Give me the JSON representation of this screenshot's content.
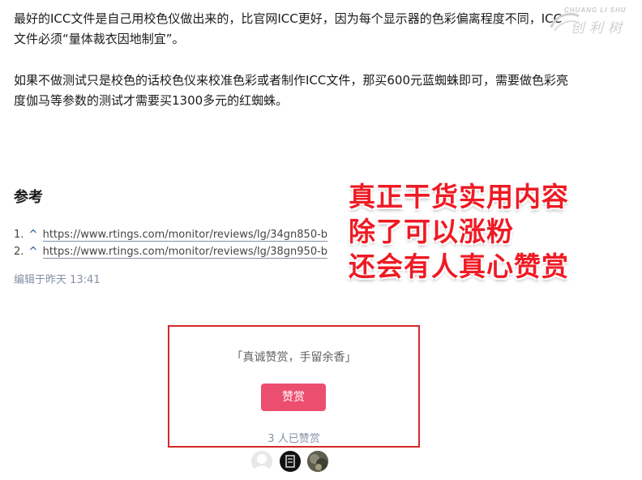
{
  "article": {
    "para1": "最好的ICC文件是自己用校色仪做出来的，比官网ICC更好，因为每个显示器的色彩偏离程度不同，ICC文件必须“量体裁衣因地制宜”。",
    "para2": "如果不做测试只是校色的话校色仪来校准色彩或者制作ICC文件，那买600元蓝蜘蛛即可，需要做色彩亮度伽马等参数的测试才需要买1300多元的红蜘蛛。"
  },
  "watermark": {
    "top": "CHUANG LI SHU",
    "bottom": "创利树"
  },
  "references": {
    "title": "参考",
    "items": [
      {
        "num": "1.",
        "caret": "^",
        "url": "https://www.rtings.com/monitor/reviews/lg/34gn850-b"
      },
      {
        "num": "2.",
        "caret": "^",
        "url": "https://www.rtings.com/monitor/reviews/lg/38gn950-b"
      }
    ]
  },
  "edited": "编辑于昨天 13:41",
  "promo": {
    "line1": "真正干货实用内容",
    "line2": "除了可以涨粉",
    "line3": "还会有人真心赞赏"
  },
  "reward": {
    "prompt": "「真诚赞赏，手留余香」",
    "button_label": "赞赏",
    "count_text": "3 人已赞赏",
    "button_color": "#ec4e70",
    "box_color": "#d32a2a"
  }
}
